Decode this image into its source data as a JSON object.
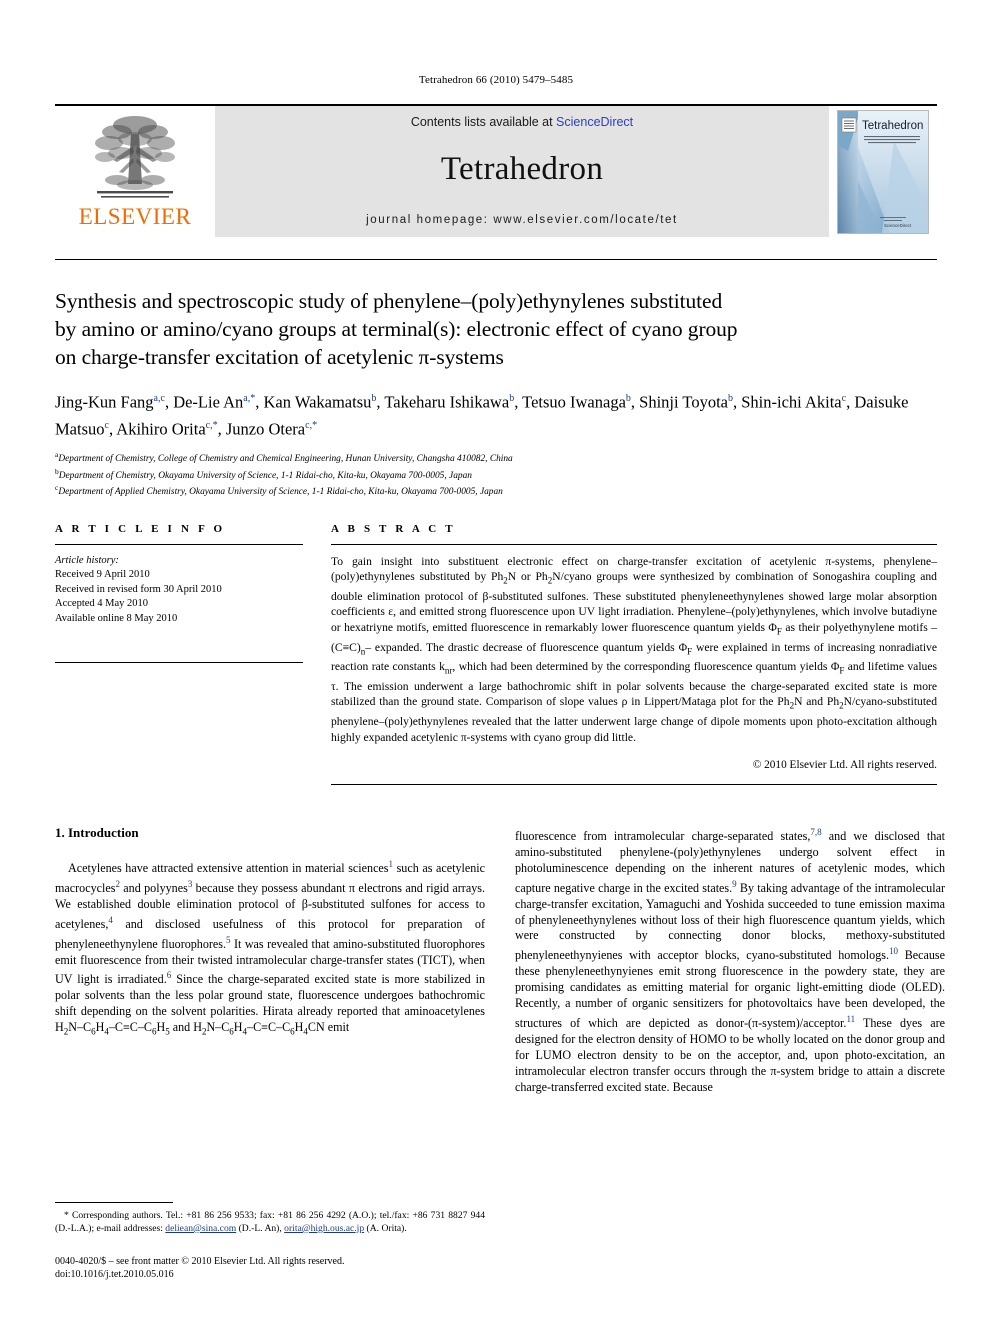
{
  "running_head": "Tetrahedron 66 (2010) 5479–5485",
  "masthead": {
    "publisher_name": "ELSEVIER",
    "contents_prefix": "Contents lists available at ",
    "sciencedirect": "ScienceDirect",
    "journal_name": "Tetrahedron",
    "homepage": "journal homepage: www.elsevier.com/locate/tet",
    "cover_title": "Tetrahedron",
    "cover_subtitle": "The International Journal for the Rapid Publication of Full Original Research Papers and Critical Reviews in Organic Chemistry",
    "cover_footer": "ScienceDirect"
  },
  "article": {
    "title_line1": "Synthesis and spectroscopic study of phenylene–(poly)ethynylenes substituted",
    "title_line2": "by amino or amino/cyano groups at terminal(s): electronic effect of cyano group",
    "title_line3": "on charge-transfer excitation of acetylenic π-systems",
    "authors": [
      {
        "name": "Jing-Kun Fang",
        "sup": "a,c",
        "sep": ", "
      },
      {
        "name": "De-Lie An",
        "sup": "a,*",
        "sep": ", "
      },
      {
        "name": "Kan Wakamatsu",
        "sup": "b",
        "sep": ", "
      },
      {
        "name": "Takeharu Ishikawa",
        "sup": "b",
        "sep": ", "
      },
      {
        "name": "Tetsuo Iwanaga",
        "sup": "b",
        "sep": ", "
      },
      {
        "name": "Shinji Toyota",
        "sup": "b",
        "sep": ", "
      },
      {
        "name": "Shin-ichi Akita",
        "sup": "c",
        "sep": ", "
      },
      {
        "name": "Daisuke Matsuo",
        "sup": "c",
        "sep": ", "
      },
      {
        "name": "Akihiro Orita",
        "sup": "c,*",
        "sep": ", "
      },
      {
        "name": "Junzo Otera",
        "sup": "c,*",
        "sep": ""
      }
    ],
    "affiliations": [
      {
        "marker": "a",
        "text": "Department of Chemistry, College of Chemistry and Chemical Engineering, Hunan University, Changsha 410082, China"
      },
      {
        "marker": "b",
        "text": "Department of Chemistry, Okayama University of Science, 1-1 Ridai-cho, Kita-ku, Okayama 700-0005, Japan"
      },
      {
        "marker": "c",
        "text": "Department of Applied Chemistry, Okayama University of Science, 1-1 Ridai-cho, Kita-ku, Okayama 700-0005, Japan"
      }
    ]
  },
  "article_info": {
    "heading": "A R T I C L E  I N F O",
    "history_label": "Article history:",
    "history": [
      "Received 9 April 2010",
      "Received in revised form 30 April 2010",
      "Accepted 4 May 2010",
      "Available online 8 May 2010"
    ]
  },
  "abstract": {
    "heading": "A B S T R A C T",
    "body": "To gain insight into substituent electronic effect on charge-transfer excitation of acetylenic π-systems, phenylene–(poly)ethynylenes substituted by Ph₂N or Ph₂N/cyano groups were synthesized by combination of Sonogashira coupling and double elimination protocol of β-substituted sulfones. These substituted phenyleneethynylenes showed large molar absorption coefficients ε, and emitted strong fluorescence upon UV light irradiation. Phenylene–(poly)ethynylenes, which involve butadiyne or hexatriyne motifs, emitted fluorescence in remarkably lower fluorescence quantum yields Φ_F as their polyethynylene motifs –(C≡C)_n– expanded. The drastic decrease of fluorescence quantum yields Φ_F were explained in terms of increasing nonradiative reaction rate constants k_nr, which had been determined by the corresponding fluorescence quantum yields Φ_F and lifetime values τ. The emission underwent a large bathochromic shift in polar solvents because the charge-separated excited state is more stabilized than the ground state. Comparison of slope values ρ in Lippert/Mataga plot for the Ph₂N and Ph₂N/cyano-substituted phenylene–(poly)ethynylenes revealed that the latter underwent large change of dipole moments upon photo-excitation although highly expanded acetylenic π-systems with cyano group did little.",
    "copyright": "© 2010 Elsevier Ltd. All rights reserved."
  },
  "introduction": {
    "number_and_title": "1.  Introduction",
    "left_paragraph": "Acetylenes have attracted extensive attention in material sciences¹ such as acetylenic macrocycles² and polyynes³ because they possess abundant π electrons and rigid arrays. We established double elimination protocol of β-substituted sulfones for access to acetylenes,⁴ and disclosed usefulness of this protocol for preparation of phenyleneethynylene fluorophores.⁵ It was revealed that amino-substituted fluorophores emit fluorescence from their twisted intramolecular charge-transfer states (TICT), when UV light is irradiated.⁶ Since the charge-separated excited state is more stabilized in polar solvents than the less polar ground state, fluorescence undergoes bathochromic shift depending on the solvent polarities. Hirata already reported that aminoacetylenes H₂N–C₆H₄–C≡C–C₆H₅ and H₂N–C₆H₄–C≡C–C₆H₄CN emit",
    "right_paragraph": "fluorescence from intramolecular charge-separated states,⁷,⁸ and we disclosed that amino-substituted phenylene-(poly)ethynylenes undergo solvent effect in photoluminescence depending on the inherent natures of acetylenic modes, which capture negative charge in the excited states.⁹ By taking advantage of the intramolecular charge-transfer excitation, Yamaguchi and Yoshida succeeded to tune emission maxima of phenyleneethynylenes without loss of their high fluorescence quantum yields, which were constructed by connecting donor blocks, methoxy-substituted phenyleneethynyienes with acceptor blocks, cyano-substituted homologs.¹⁰ Because these phenyleneethynyienes emit strong fluorescence in the powdery state, they are promising candidates as emitting material for organic light-emitting diode (OLED). Recently, a number of organic sensitizers for photovoltaics have been developed, the structures of which are depicted as donor-(π-system)/acceptor.¹¹ These dyes are designed for the electron density of HOMO to be wholly located on the donor group and for LUMO electron density to be on the acceptor, and, upon photo-excitation, an intramolecular electron transfer occurs through the π-system bridge to attain a discrete charge-transferred excited state. Because"
  },
  "footnote": {
    "text_part1": "* Corresponding authors. Tel.: +81 86 256 9533; fax: +81 86 256 4292 (A.O.); tel./fax: +86 731 8827 944 (D.-L.A.); e-mail addresses: ",
    "email1": "deliean@sina.com",
    "text_part2": " (D.-L. An), ",
    "email2": "orita@high.ous.ac.jp",
    "text_part3": " (A. Orita)."
  },
  "imprint": {
    "line1": "0040-4020/$ – see front matter © 2010 Elsevier Ltd. All rights reserved.",
    "line2": "doi:10.1016/j.tet.2010.05.016"
  },
  "colors": {
    "elsevier_orange": "#F06C00",
    "link_blue": "#2b3fc4",
    "ref_blue": "#1b3a8c",
    "band_gray": "#e3e3e3"
  }
}
